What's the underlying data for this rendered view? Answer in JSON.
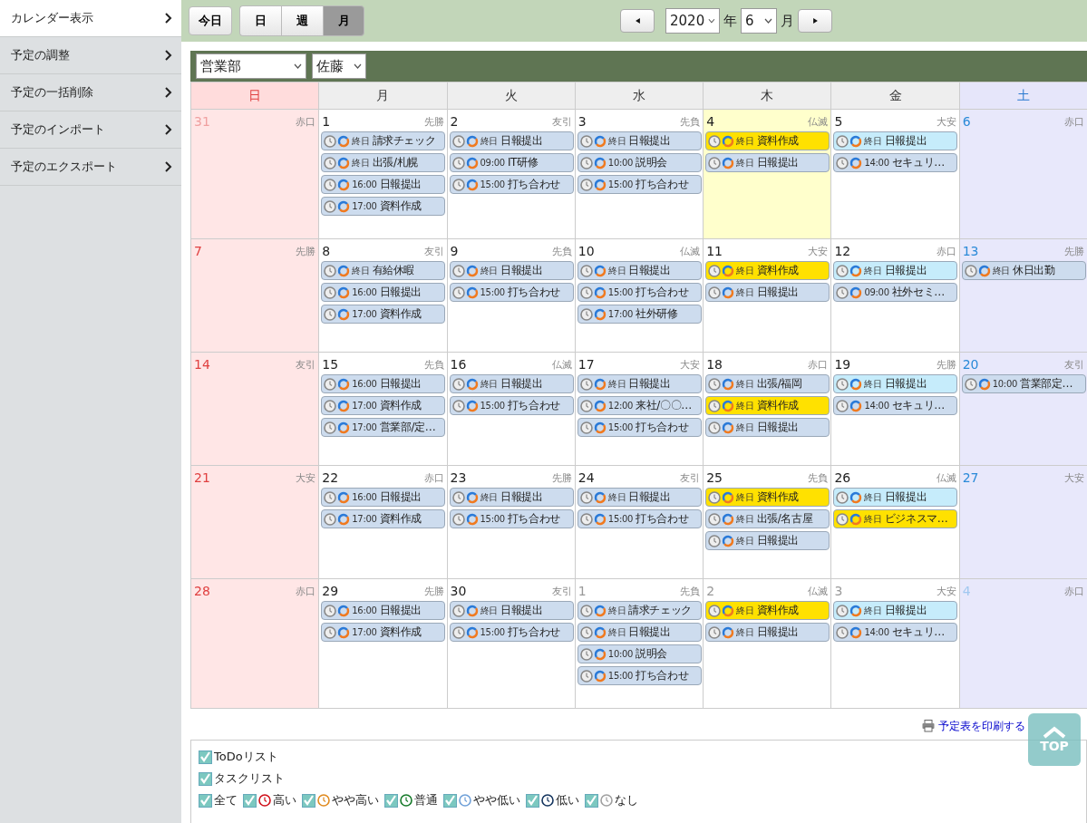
{
  "sidebar": {
    "items": [
      {
        "label": "カレンダー表示",
        "selected": true
      },
      {
        "label": "予定の調整",
        "selected": false
      },
      {
        "label": "予定の一括削除",
        "selected": false
      },
      {
        "label": "予定のインポート",
        "selected": false
      },
      {
        "label": "予定のエクスポート",
        "selected": false
      }
    ]
  },
  "toolbar": {
    "today_button": "今日",
    "views": [
      {
        "label": "日",
        "selected": false
      },
      {
        "label": "週",
        "selected": false
      },
      {
        "label": "月",
        "selected": true
      }
    ],
    "year": "2020",
    "year_unit": "年",
    "month": "6",
    "month_unit": "月"
  },
  "filters": {
    "department": "営業部",
    "person": "佐藤"
  },
  "calendar": {
    "weekdays": [
      "日",
      "月",
      "火",
      "水",
      "木",
      "金",
      "土"
    ],
    "weeks": [
      {
        "days": [
          {
            "date": "31",
            "rokuyo": "赤口",
            "other_month": true,
            "today": false
          },
          {
            "date": "1",
            "rokuyo": "先勝",
            "other_month": false,
            "today": false,
            "events": [
              {
                "time": "終日",
                "title": "請求チェック",
                "color": "#cddcee"
              },
              {
                "time": "終日",
                "title": "出張/札幌",
                "color": "#cddcee"
              },
              {
                "time": "16:00",
                "title": "日報提出",
                "color": "#cddcee"
              },
              {
                "time": "17:00",
                "title": "資料作成",
                "color": "#cddcee"
              }
            ]
          },
          {
            "date": "2",
            "rokuyo": "友引",
            "other_month": false,
            "today": false,
            "events": [
              {
                "time": "終日",
                "title": "日報提出",
                "color": "#cddcee"
              },
              {
                "time": "09:00",
                "title": "IT研修",
                "color": "#cddcee"
              },
              {
                "time": "15:00",
                "title": "打ち合わせ",
                "color": "#cddcee"
              }
            ]
          },
          {
            "date": "3",
            "rokuyo": "先負",
            "other_month": false,
            "today": false,
            "events": [
              {
                "time": "終日",
                "title": "日報提出",
                "color": "#cddcee"
              },
              {
                "time": "10:00",
                "title": "説明会",
                "color": "#cddcee"
              },
              {
                "time": "15:00",
                "title": "打ち合わせ",
                "color": "#cddcee"
              }
            ]
          },
          {
            "date": "4",
            "rokuyo": "仏滅",
            "other_month": false,
            "today": true,
            "events": [
              {
                "time": "終日",
                "title": "資料作成",
                "color": "#ffe100"
              },
              {
                "time": "終日",
                "title": "日報提出",
                "color": "#cddcee"
              }
            ]
          },
          {
            "date": "5",
            "rokuyo": "大安",
            "other_month": false,
            "today": false,
            "events": [
              {
                "time": "終日",
                "title": "日報提出",
                "color": "#c6ecfb"
              },
              {
                "time": "14:00",
                "title": "セキュリ…",
                "color": "#cddcee"
              }
            ]
          },
          {
            "date": "6",
            "rokuyo": "赤口",
            "other_month": false,
            "today": false
          }
        ]
      },
      {
        "days": [
          {
            "date": "7",
            "rokuyo": "先勝",
            "other_month": false,
            "today": false
          },
          {
            "date": "8",
            "rokuyo": "友引",
            "other_month": false,
            "today": false,
            "events": [
              {
                "time": "終日",
                "title": "有給休暇",
                "color": "#cddcee"
              },
              {
                "time": "16:00",
                "title": "日報提出",
                "color": "#cddcee"
              },
              {
                "time": "17:00",
                "title": "資料作成",
                "color": "#cddcee"
              }
            ]
          },
          {
            "date": "9",
            "rokuyo": "先負",
            "other_month": false,
            "today": false,
            "events": [
              {
                "time": "終日",
                "title": "日報提出",
                "color": "#cddcee"
              },
              {
                "time": "15:00",
                "title": "打ち合わせ",
                "color": "#cddcee"
              }
            ]
          },
          {
            "date": "10",
            "rokuyo": "仏滅",
            "other_month": false,
            "today": false,
            "events": [
              {
                "time": "終日",
                "title": "日報提出",
                "color": "#cddcee"
              },
              {
                "time": "15:00",
                "title": "打ち合わせ",
                "color": "#cddcee"
              },
              {
                "time": "17:00",
                "title": "社外研修",
                "color": "#cddcee"
              }
            ]
          },
          {
            "date": "11",
            "rokuyo": "大安",
            "other_month": false,
            "today": false,
            "events": [
              {
                "time": "終日",
                "title": "資料作成",
                "color": "#ffe100"
              },
              {
                "time": "終日",
                "title": "日報提出",
                "color": "#cddcee"
              }
            ]
          },
          {
            "date": "12",
            "rokuyo": "赤口",
            "other_month": false,
            "today": false,
            "events": [
              {
                "time": "終日",
                "title": "日報提出",
                "color": "#c6ecfb"
              },
              {
                "time": "09:00",
                "title": "社外セミ…",
                "color": "#cddcee"
              }
            ]
          },
          {
            "date": "13",
            "rokuyo": "先勝",
            "other_month": false,
            "today": false,
            "events": [
              {
                "time": "終日",
                "title": "休日出勤",
                "color": "#cddcee"
              }
            ]
          }
        ]
      },
      {
        "days": [
          {
            "date": "14",
            "rokuyo": "友引",
            "other_month": false,
            "today": false
          },
          {
            "date": "15",
            "rokuyo": "先負",
            "other_month": false,
            "today": false,
            "events": [
              {
                "time": "16:00",
                "title": "日報提出",
                "color": "#cddcee"
              },
              {
                "time": "17:00",
                "title": "資料作成",
                "color": "#cddcee"
              },
              {
                "time": "17:00",
                "title": "営業部/定…",
                "color": "#cddcee"
              }
            ]
          },
          {
            "date": "16",
            "rokuyo": "仏滅",
            "other_month": false,
            "today": false,
            "events": [
              {
                "time": "終日",
                "title": "日報提出",
                "color": "#cddcee"
              },
              {
                "time": "15:00",
                "title": "打ち合わせ",
                "color": "#cddcee"
              }
            ]
          },
          {
            "date": "17",
            "rokuyo": "大安",
            "other_month": false,
            "today": false,
            "events": [
              {
                "time": "終日",
                "title": "日報提出",
                "color": "#cddcee"
              },
              {
                "time": "12:00",
                "title": "来社/〇〇…",
                "color": "#cddcee"
              },
              {
                "time": "15:00",
                "title": "打ち合わせ",
                "color": "#cddcee"
              }
            ]
          },
          {
            "date": "18",
            "rokuyo": "赤口",
            "other_month": false,
            "today": false,
            "events": [
              {
                "time": "終日",
                "title": "出張/福岡",
                "color": "#cddcee"
              },
              {
                "time": "終日",
                "title": "資料作成",
                "color": "#ffe100"
              },
              {
                "time": "終日",
                "title": "日報提出",
                "color": "#cddcee"
              }
            ]
          },
          {
            "date": "19",
            "rokuyo": "先勝",
            "other_month": false,
            "today": false,
            "events": [
              {
                "time": "終日",
                "title": "日報提出",
                "color": "#c6ecfb"
              },
              {
                "time": "14:00",
                "title": "セキュリ…",
                "color": "#cddcee"
              }
            ]
          },
          {
            "date": "20",
            "rokuyo": "友引",
            "other_month": false,
            "today": false,
            "events": [
              {
                "time": "10:00",
                "title": "営業部定…",
                "color": "#cddcee"
              }
            ]
          }
        ]
      },
      {
        "days": [
          {
            "date": "21",
            "rokuyo": "大安",
            "other_month": false,
            "today": false
          },
          {
            "date": "22",
            "rokuyo": "赤口",
            "other_month": false,
            "today": false,
            "events": [
              {
                "time": "16:00",
                "title": "日報提出",
                "color": "#cddcee"
              },
              {
                "time": "17:00",
                "title": "資料作成",
                "color": "#cddcee"
              }
            ]
          },
          {
            "date": "23",
            "rokuyo": "先勝",
            "other_month": false,
            "today": false,
            "events": [
              {
                "time": "終日",
                "title": "日報提出",
                "color": "#cddcee"
              },
              {
                "time": "15:00",
                "title": "打ち合わせ",
                "color": "#cddcee"
              }
            ]
          },
          {
            "date": "24",
            "rokuyo": "友引",
            "other_month": false,
            "today": false,
            "events": [
              {
                "time": "終日",
                "title": "日報提出",
                "color": "#cddcee"
              },
              {
                "time": "15:00",
                "title": "打ち合わせ",
                "color": "#cddcee"
              }
            ]
          },
          {
            "date": "25",
            "rokuyo": "先負",
            "other_month": false,
            "today": false,
            "events": [
              {
                "time": "終日",
                "title": "資料作成",
                "color": "#ffe100"
              },
              {
                "time": "終日",
                "title": "出張/名古屋",
                "color": "#cddcee"
              },
              {
                "time": "終日",
                "title": "日報提出",
                "color": "#cddcee"
              }
            ]
          },
          {
            "date": "26",
            "rokuyo": "仏滅",
            "other_month": false,
            "today": false,
            "events": [
              {
                "time": "終日",
                "title": "日報提出",
                "color": "#c6ecfb"
              },
              {
                "time": "終日",
                "title": "ビジネスマ…",
                "color": "#ffe100"
              }
            ]
          },
          {
            "date": "27",
            "rokuyo": "大安",
            "other_month": false,
            "today": false
          }
        ]
      },
      {
        "days": [
          {
            "date": "28",
            "rokuyo": "赤口",
            "other_month": false,
            "today": false
          },
          {
            "date": "29",
            "rokuyo": "先勝",
            "other_month": false,
            "today": false,
            "events": [
              {
                "time": "16:00",
                "title": "日報提出",
                "color": "#cddcee"
              },
              {
                "time": "17:00",
                "title": "資料作成",
                "color": "#cddcee"
              }
            ]
          },
          {
            "date": "30",
            "rokuyo": "友引",
            "other_month": false,
            "today": false,
            "events": [
              {
                "time": "終日",
                "title": "日報提出",
                "color": "#cddcee"
              },
              {
                "time": "15:00",
                "title": "打ち合わせ",
                "color": "#cddcee"
              }
            ]
          },
          {
            "date": "1",
            "rokuyo": "先負",
            "other_month": true,
            "today": false,
            "events": [
              {
                "time": "終日",
                "title": "請求チェック",
                "color": "#cddcee"
              },
              {
                "time": "終日",
                "title": "日報提出",
                "color": "#cddcee"
              },
              {
                "time": "10:00",
                "title": "説明会",
                "color": "#cddcee"
              },
              {
                "time": "15:00",
                "title": "打ち合わせ",
                "color": "#cddcee"
              }
            ]
          },
          {
            "date": "2",
            "rokuyo": "仏滅",
            "other_month": true,
            "today": false,
            "events": [
              {
                "time": "終日",
                "title": "資料作成",
                "color": "#ffe100"
              },
              {
                "time": "終日",
                "title": "日報提出",
                "color": "#cddcee"
              }
            ]
          },
          {
            "date": "3",
            "rokuyo": "大安",
            "other_month": true,
            "today": false,
            "events": [
              {
                "time": "終日",
                "title": "日報提出",
                "color": "#c6ecfb"
              },
              {
                "time": "14:00",
                "title": "セキュリ…",
                "color": "#cddcee"
              }
            ]
          },
          {
            "date": "4",
            "rokuyo": "赤口",
            "other_month": true,
            "today": false
          }
        ]
      }
    ]
  },
  "print_link": "予定表を印刷する",
  "legend": {
    "lists": [
      {
        "label": "ToDoリスト",
        "checked": true
      },
      {
        "label": "タスクリスト",
        "checked": true
      }
    ],
    "priorities": [
      {
        "label": "全て",
        "checked": true
      },
      {
        "label": "高い",
        "checked": true,
        "color": "#d0101a"
      },
      {
        "label": "やや高い",
        "checked": true,
        "color": "#e08a1e"
      },
      {
        "label": "普通",
        "checked": true,
        "color": "#167a2a"
      },
      {
        "label": "やや低い",
        "checked": true,
        "color": "#6fa0d8"
      },
      {
        "label": "低い",
        "checked": true,
        "color": "#14345e"
      },
      {
        "label": "なし",
        "checked": true,
        "color": "#a0a0a0"
      }
    ]
  },
  "top_button": "TOP"
}
